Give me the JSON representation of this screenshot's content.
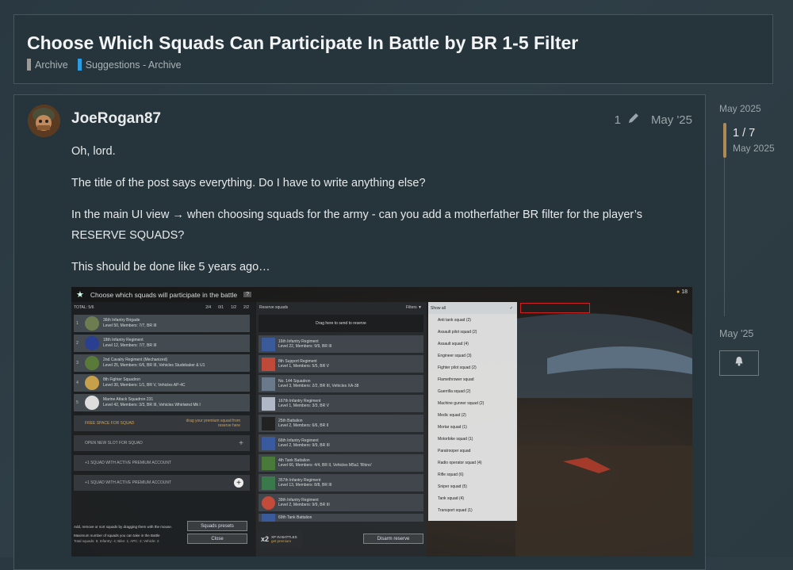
{
  "topic": {
    "title": "Choose Which Squads Can Participate In Battle by BR 1-5 Filter",
    "categories": [
      {
        "label": "Archive",
        "color": "#9a9a9a"
      },
      {
        "label": "Suggestions - Archive",
        "color": "#2c9be0"
      }
    ]
  },
  "post": {
    "username": "JoeRogan87",
    "edit_count": "1",
    "date": "May '25",
    "paragraphs": [
      "Oh, lord.",
      "The title of the post says everything. Do I have to write anything else?",
      "In the main UI view → when choosing squads for the army - can you add a motherfather BR filter for the player’s RESERVE SQUADS?",
      "This should be done like 5 years ago…"
    ]
  },
  "screenshot": {
    "title": "Choose which squads will participate in the battle",
    "total": "TOTAL: 5/6",
    "counters": [
      "2/4",
      "0/1",
      "1/2",
      "2/2"
    ],
    "squads": [
      {
        "num": "1",
        "name": "36th Infantry Brigade",
        "info": "Level 50, Members: 7/7, BR III"
      },
      {
        "num": "2",
        "name": "18th Infantry Regiment",
        "info": "Level 12, Members: 7/7, BR III"
      },
      {
        "num": "3",
        "name": "2nd Cavalry Regiment (Mechanized)",
        "info": "Level 25, Members: 6/6, BR III, Vehicles Studebaker & U1"
      },
      {
        "num": "4",
        "name": "8th Fighter Squadron",
        "info": "Level 30, Members: 1/1, BR V, Vehicles AP-4C"
      },
      {
        "num": "5",
        "name": "Marine Attack Squadron 231",
        "info": "Level 42, Members: 3/3, BR III, Vehicles Whirlwind Mk I"
      }
    ],
    "free_slot": "FREE SPACE FOR SQUAD",
    "free_hint": "drag your premium squad from reserve here",
    "open_slot": "OPEN NEW SLOT FOR SQUAD",
    "premium_slot": "+1 SQUAD WITH ACTIVE PREMIUM ACCOUNT",
    "hint": "Add, remove or sort squads by dragging them with the mouse.",
    "max_label": "Maximum number of squads you can take in the Battle",
    "max_detail": "Total squads: 5; Infantry: 4; Bike: 1; APC: 2; Vehicle: 2",
    "presets_btn": "Squads presets",
    "close_btn": "Close",
    "reserve_title": "Reserve squads",
    "filters_label": "Filters",
    "drag_hint": "Drag here to send to reserve",
    "reserve": [
      {
        "name": "16th Infantry Regiment",
        "info": "Level 22, Members: 9/9, BR III"
      },
      {
        "name": "8th Support Regiment",
        "info": "Level 1, Members: 5/5, BR V"
      },
      {
        "name": "No. 144 Squadron",
        "info": "Level 3, Members: 2/2, BR III, Vehicles XA-38"
      },
      {
        "name": "167th Infantry Regiment",
        "info": "Level 1, Members: 3/3, BR V"
      },
      {
        "name": "25th Battalion",
        "info": "Level 2, Members: 6/6, BR II"
      },
      {
        "name": "66th Infantry Regiment",
        "info": "Level 2, Members: 9/9, BR III"
      },
      {
        "name": "4th Tank Battalion",
        "info": "Level 66, Members: 4/4, BR II, Vehicles M5a1 'Rhino'"
      },
      {
        "name": "357th Infantry Regiment",
        "info": "Level 13, Members: 8/8, BR III"
      },
      {
        "name": "39th Infantry Regiment",
        "info": "Level 2, Members: 9/9, BR III"
      },
      {
        "name": "69th Tank Battalion",
        "info": ""
      }
    ],
    "xp_mult": "x2",
    "xp_label": "XP IN BATTLES",
    "xp_sub": "get premium",
    "disarm_btn": "Disarm reserve",
    "filter_options": [
      "Show all",
      "Anti tank squad (2)",
      "Assault pilot squad (2)",
      "Assault squad (4)",
      "Engineer squad (3)",
      "Fighter pilot squad (2)",
      "Flamethrower squad",
      "Guerrilla squad (2)",
      "Machine gunner squad (2)",
      "Medic squad (2)",
      "Mortar squad (1)",
      "Motorbike squad (1)",
      "Paratrooper squad",
      "Radio operator squad (4)",
      "Rifle squad (6)",
      "Sniper squad (5)",
      "Tank squad (4)",
      "Transport squad (1)"
    ],
    "gold": "18"
  },
  "timeline": {
    "start": "May 2025",
    "position": "1 / 7",
    "position_date": "May 2025",
    "end": "May '25",
    "bell_icon": "bell-icon"
  }
}
